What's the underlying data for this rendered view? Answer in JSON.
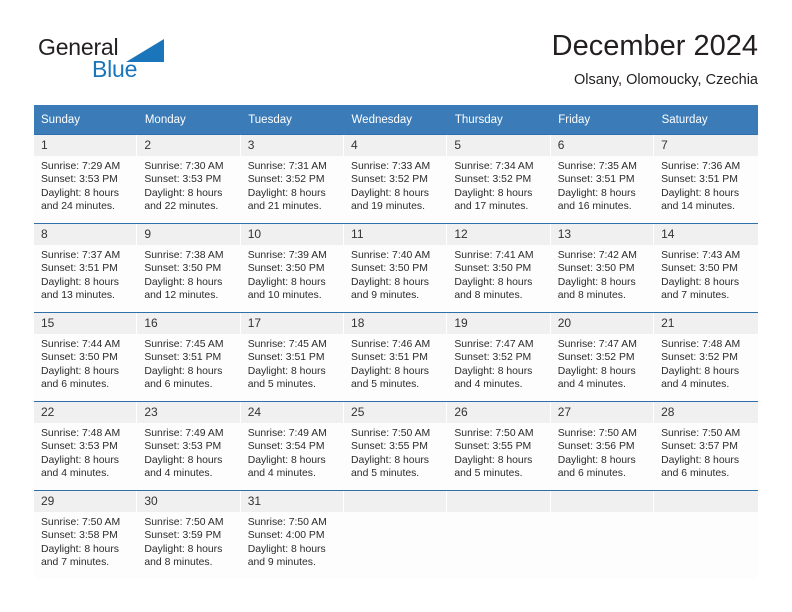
{
  "logo": {
    "word_top": "General",
    "word_bottom": "Blue",
    "triangle_color": "#1b75bb",
    "text_color": "#231f20"
  },
  "header": {
    "title": "December 2024",
    "subtitle": "Olsany, Olomoucky, Czechia"
  },
  "theme": {
    "header_bg": "#3b7cb8",
    "header_text": "#ffffff",
    "daynum_bg": "#f0f0f0",
    "row_divider": "#2f6fab",
    "cell_bg": "#fdfdfd"
  },
  "weekday_headers": [
    "Sunday",
    "Monday",
    "Tuesday",
    "Wednesday",
    "Thursday",
    "Friday",
    "Saturday"
  ],
  "labels": {
    "sunrise_prefix": "Sunrise:",
    "sunset_prefix": "Sunset:",
    "daylight_prefix": "Daylight:"
  },
  "weeks": [
    [
      {
        "day": "1",
        "sunrise": "Sunrise: 7:29 AM",
        "sunset": "Sunset: 3:53 PM",
        "daylight_1": "Daylight: 8 hours",
        "daylight_2": "and 24 minutes."
      },
      {
        "day": "2",
        "sunrise": "Sunrise: 7:30 AM",
        "sunset": "Sunset: 3:53 PM",
        "daylight_1": "Daylight: 8 hours",
        "daylight_2": "and 22 minutes."
      },
      {
        "day": "3",
        "sunrise": "Sunrise: 7:31 AM",
        "sunset": "Sunset: 3:52 PM",
        "daylight_1": "Daylight: 8 hours",
        "daylight_2": "and 21 minutes."
      },
      {
        "day": "4",
        "sunrise": "Sunrise: 7:33 AM",
        "sunset": "Sunset: 3:52 PM",
        "daylight_1": "Daylight: 8 hours",
        "daylight_2": "and 19 minutes."
      },
      {
        "day": "5",
        "sunrise": "Sunrise: 7:34 AM",
        "sunset": "Sunset: 3:52 PM",
        "daylight_1": "Daylight: 8 hours",
        "daylight_2": "and 17 minutes."
      },
      {
        "day": "6",
        "sunrise": "Sunrise: 7:35 AM",
        "sunset": "Sunset: 3:51 PM",
        "daylight_1": "Daylight: 8 hours",
        "daylight_2": "and 16 minutes."
      },
      {
        "day": "7",
        "sunrise": "Sunrise: 7:36 AM",
        "sunset": "Sunset: 3:51 PM",
        "daylight_1": "Daylight: 8 hours",
        "daylight_2": "and 14 minutes."
      }
    ],
    [
      {
        "day": "8",
        "sunrise": "Sunrise: 7:37 AM",
        "sunset": "Sunset: 3:51 PM",
        "daylight_1": "Daylight: 8 hours",
        "daylight_2": "and 13 minutes."
      },
      {
        "day": "9",
        "sunrise": "Sunrise: 7:38 AM",
        "sunset": "Sunset: 3:50 PM",
        "daylight_1": "Daylight: 8 hours",
        "daylight_2": "and 12 minutes."
      },
      {
        "day": "10",
        "sunrise": "Sunrise: 7:39 AM",
        "sunset": "Sunset: 3:50 PM",
        "daylight_1": "Daylight: 8 hours",
        "daylight_2": "and 10 minutes."
      },
      {
        "day": "11",
        "sunrise": "Sunrise: 7:40 AM",
        "sunset": "Sunset: 3:50 PM",
        "daylight_1": "Daylight: 8 hours",
        "daylight_2": "and 9 minutes."
      },
      {
        "day": "12",
        "sunrise": "Sunrise: 7:41 AM",
        "sunset": "Sunset: 3:50 PM",
        "daylight_1": "Daylight: 8 hours",
        "daylight_2": "and 8 minutes."
      },
      {
        "day": "13",
        "sunrise": "Sunrise: 7:42 AM",
        "sunset": "Sunset: 3:50 PM",
        "daylight_1": "Daylight: 8 hours",
        "daylight_2": "and 8 minutes."
      },
      {
        "day": "14",
        "sunrise": "Sunrise: 7:43 AM",
        "sunset": "Sunset: 3:50 PM",
        "daylight_1": "Daylight: 8 hours",
        "daylight_2": "and 7 minutes."
      }
    ],
    [
      {
        "day": "15",
        "sunrise": "Sunrise: 7:44 AM",
        "sunset": "Sunset: 3:50 PM",
        "daylight_1": "Daylight: 8 hours",
        "daylight_2": "and 6 minutes."
      },
      {
        "day": "16",
        "sunrise": "Sunrise: 7:45 AM",
        "sunset": "Sunset: 3:51 PM",
        "daylight_1": "Daylight: 8 hours",
        "daylight_2": "and 6 minutes."
      },
      {
        "day": "17",
        "sunrise": "Sunrise: 7:45 AM",
        "sunset": "Sunset: 3:51 PM",
        "daylight_1": "Daylight: 8 hours",
        "daylight_2": "and 5 minutes."
      },
      {
        "day": "18",
        "sunrise": "Sunrise: 7:46 AM",
        "sunset": "Sunset: 3:51 PM",
        "daylight_1": "Daylight: 8 hours",
        "daylight_2": "and 5 minutes."
      },
      {
        "day": "19",
        "sunrise": "Sunrise: 7:47 AM",
        "sunset": "Sunset: 3:52 PM",
        "daylight_1": "Daylight: 8 hours",
        "daylight_2": "and 4 minutes."
      },
      {
        "day": "20",
        "sunrise": "Sunrise: 7:47 AM",
        "sunset": "Sunset: 3:52 PM",
        "daylight_1": "Daylight: 8 hours",
        "daylight_2": "and 4 minutes."
      },
      {
        "day": "21",
        "sunrise": "Sunrise: 7:48 AM",
        "sunset": "Sunset: 3:52 PM",
        "daylight_1": "Daylight: 8 hours",
        "daylight_2": "and 4 minutes."
      }
    ],
    [
      {
        "day": "22",
        "sunrise": "Sunrise: 7:48 AM",
        "sunset": "Sunset: 3:53 PM",
        "daylight_1": "Daylight: 8 hours",
        "daylight_2": "and 4 minutes."
      },
      {
        "day": "23",
        "sunrise": "Sunrise: 7:49 AM",
        "sunset": "Sunset: 3:53 PM",
        "daylight_1": "Daylight: 8 hours",
        "daylight_2": "and 4 minutes."
      },
      {
        "day": "24",
        "sunrise": "Sunrise: 7:49 AM",
        "sunset": "Sunset: 3:54 PM",
        "daylight_1": "Daylight: 8 hours",
        "daylight_2": "and 4 minutes."
      },
      {
        "day": "25",
        "sunrise": "Sunrise: 7:50 AM",
        "sunset": "Sunset: 3:55 PM",
        "daylight_1": "Daylight: 8 hours",
        "daylight_2": "and 5 minutes."
      },
      {
        "day": "26",
        "sunrise": "Sunrise: 7:50 AM",
        "sunset": "Sunset: 3:55 PM",
        "daylight_1": "Daylight: 8 hours",
        "daylight_2": "and 5 minutes."
      },
      {
        "day": "27",
        "sunrise": "Sunrise: 7:50 AM",
        "sunset": "Sunset: 3:56 PM",
        "daylight_1": "Daylight: 8 hours",
        "daylight_2": "and 6 minutes."
      },
      {
        "day": "28",
        "sunrise": "Sunrise: 7:50 AM",
        "sunset": "Sunset: 3:57 PM",
        "daylight_1": "Daylight: 8 hours",
        "daylight_2": "and 6 minutes."
      }
    ],
    [
      {
        "day": "29",
        "sunrise": "Sunrise: 7:50 AM",
        "sunset": "Sunset: 3:58 PM",
        "daylight_1": "Daylight: 8 hours",
        "daylight_2": "and 7 minutes."
      },
      {
        "day": "30",
        "sunrise": "Sunrise: 7:50 AM",
        "sunset": "Sunset: 3:59 PM",
        "daylight_1": "Daylight: 8 hours",
        "daylight_2": "and 8 minutes."
      },
      {
        "day": "31",
        "sunrise": "Sunrise: 7:50 AM",
        "sunset": "Sunset: 4:00 PM",
        "daylight_1": "Daylight: 8 hours",
        "daylight_2": "and 9 minutes."
      },
      {
        "day": "",
        "sunrise": "",
        "sunset": "",
        "daylight_1": "",
        "daylight_2": ""
      },
      {
        "day": "",
        "sunrise": "",
        "sunset": "",
        "daylight_1": "",
        "daylight_2": ""
      },
      {
        "day": "",
        "sunrise": "",
        "sunset": "",
        "daylight_1": "",
        "daylight_2": ""
      },
      {
        "day": "",
        "sunrise": "",
        "sunset": "",
        "daylight_1": "",
        "daylight_2": ""
      }
    ]
  ]
}
